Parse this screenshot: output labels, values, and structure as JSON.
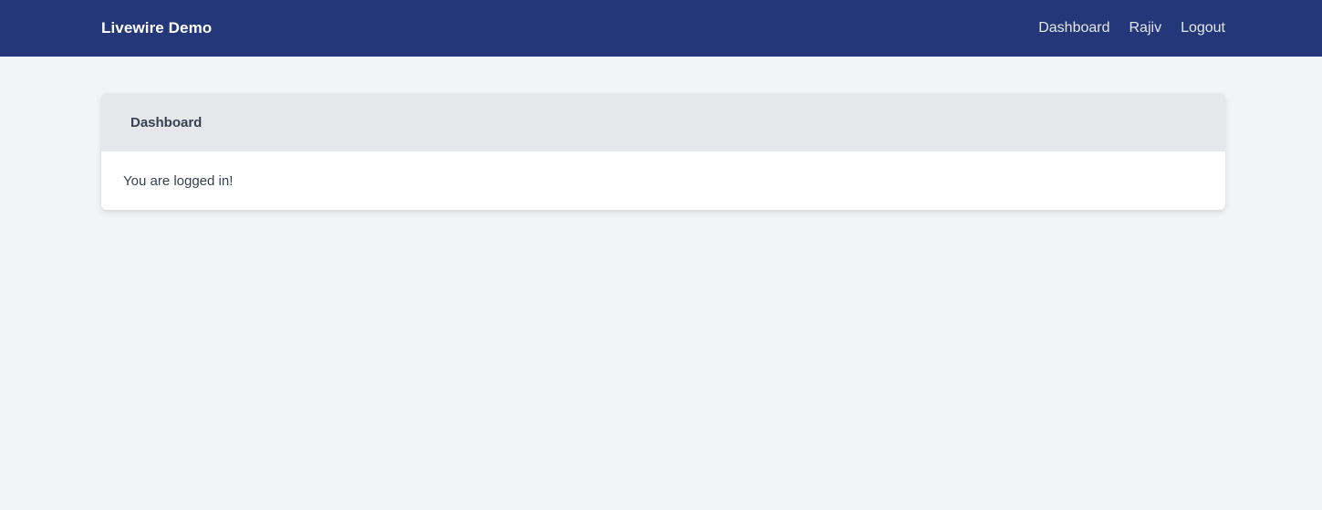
{
  "header": {
    "brand": "Livewire Demo",
    "links": [
      {
        "label": "Dashboard"
      },
      {
        "label": "Rajiv"
      },
      {
        "label": "Logout"
      }
    ]
  },
  "card": {
    "title": "Dashboard",
    "message": "You are logged in!"
  },
  "colors": {
    "navbar": "#233779",
    "page_background": "#f3f4f6",
    "card_header": "#e5e7eb"
  }
}
